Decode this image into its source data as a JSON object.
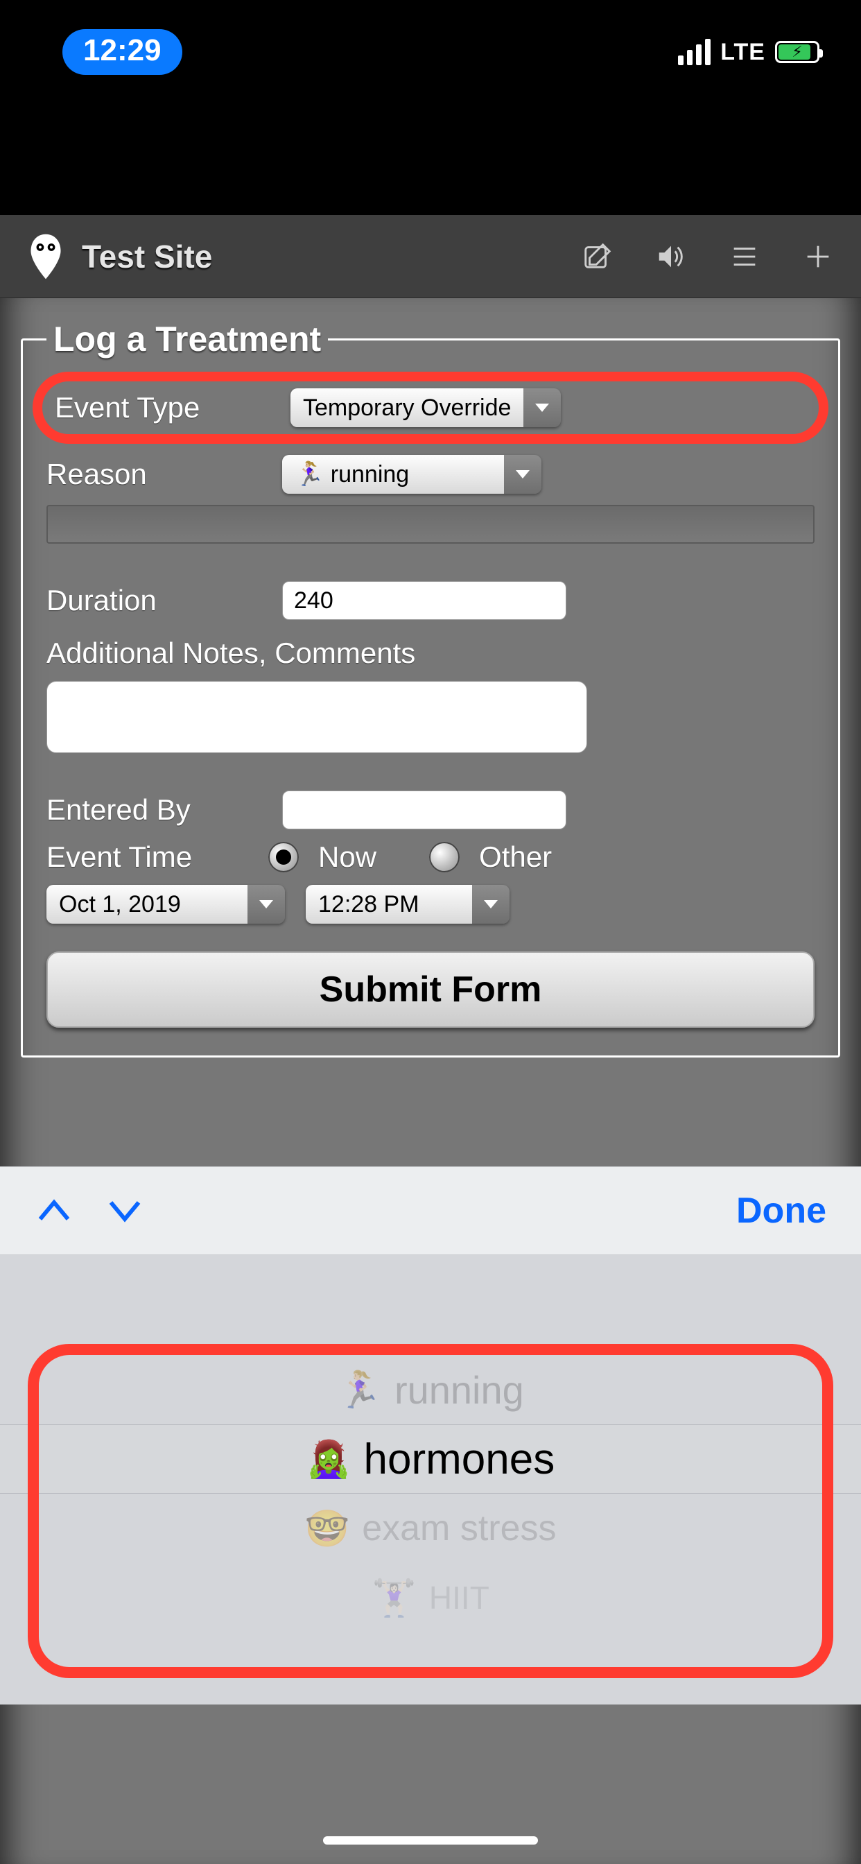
{
  "status": {
    "time": "12:29",
    "network": "LTE"
  },
  "header": {
    "title": "Test Site"
  },
  "form": {
    "legend": "Log a Treatment",
    "event_type_label": "Event Type",
    "event_type_value": "Temporary Override",
    "reason_label": "Reason",
    "reason_value": "🏃🏼‍♀️ running",
    "reason_extra_value": "",
    "duration_label": "Duration",
    "duration_value": "240",
    "notes_label": "Additional Notes, Comments",
    "notes_value": "",
    "entered_by_label": "Entered By",
    "entered_by_value": "",
    "event_time_label": "Event Time",
    "radio_now": "Now",
    "radio_other": "Other",
    "date_value": "Oct 1, 2019",
    "time_value": "12:28 PM",
    "submit_label": "Submit Form"
  },
  "accessory": {
    "done": "Done"
  },
  "picker": {
    "items": [
      {
        "emoji": "🏃🏼‍♀️",
        "label": "running"
      },
      {
        "emoji": "🧟‍♀️",
        "label": "hormones"
      },
      {
        "emoji": "🤓",
        "label": "exam stress"
      },
      {
        "emoji": "🏋🏻‍♀️",
        "label": "HIIT"
      }
    ],
    "selected_index": 1
  }
}
